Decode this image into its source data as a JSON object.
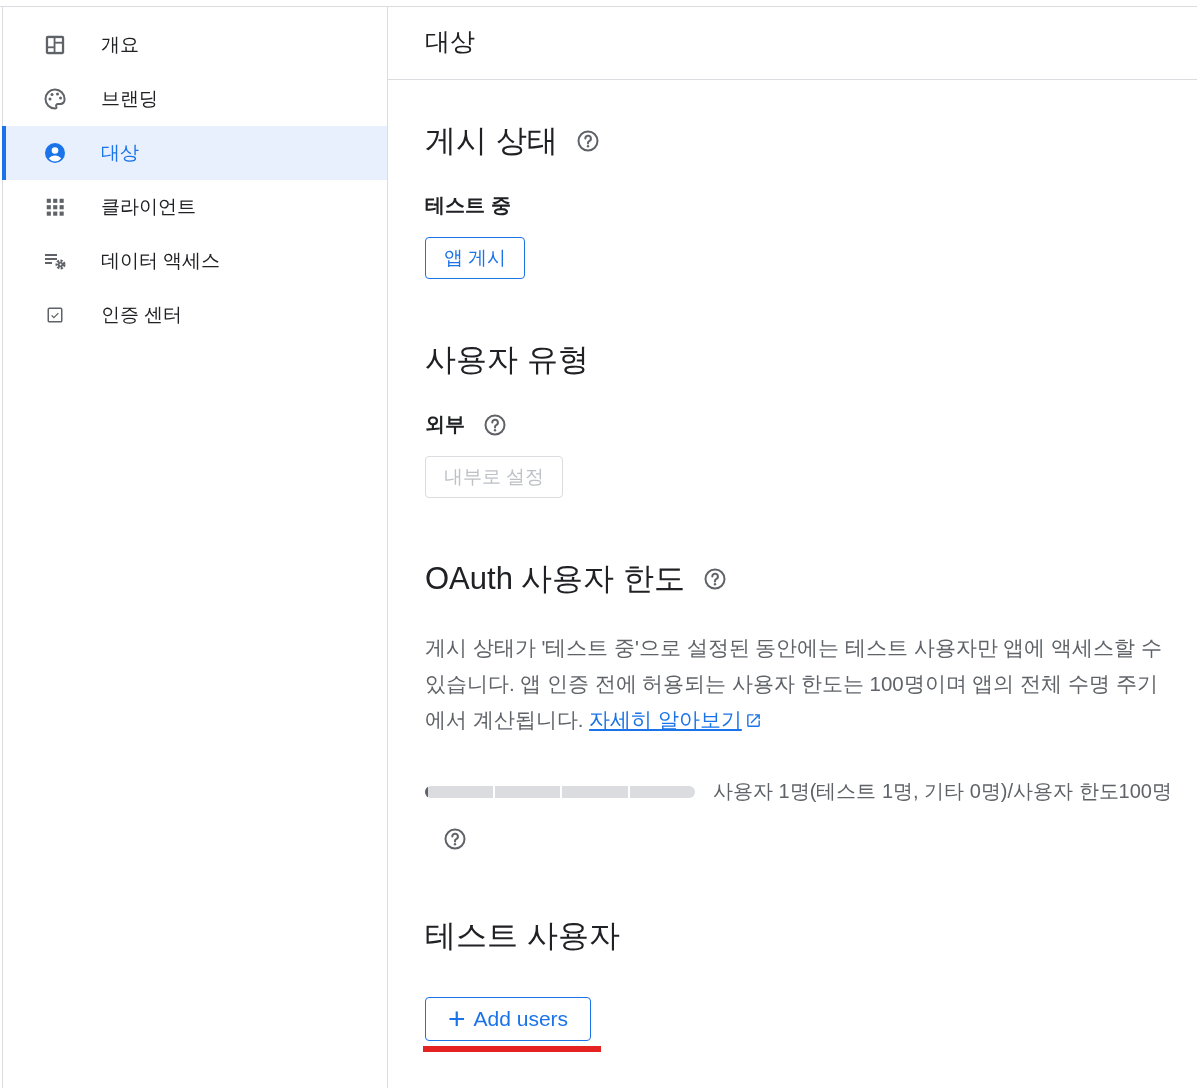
{
  "sidebar": {
    "items": [
      {
        "label": "개요",
        "selected": false
      },
      {
        "label": "브랜딩",
        "selected": false
      },
      {
        "label": "대상",
        "selected": true
      },
      {
        "label": "클라이언트",
        "selected": false
      },
      {
        "label": "데이터 액세스",
        "selected": false
      },
      {
        "label": "인증 센터",
        "selected": false
      }
    ]
  },
  "page_title": "대상",
  "publishing_status": {
    "heading": "게시 상태",
    "status": "테스트 중",
    "button": {
      "label": "앱 게시",
      "disabled": false
    }
  },
  "user_type": {
    "heading": "사용자 유형",
    "type": "외부",
    "button": {
      "label": "내부로 설정",
      "disabled": true
    }
  },
  "user_cap": {
    "heading": "OAuth 사용자 한도",
    "description": "게시 상태가 '테스트 중'으로 설정된 동안에는 테스트 사용자만 앱에 액세스할 수 있습니다. 앱 인증 전에 허용되는 사용자 한도는 100명이며 앱의 전체 수명 주기에서 계산됩니다.",
    "link": "자세히 알아보기",
    "level": 0.01,
    "reading": "사용자 1명(테스트 1명, 기타 0명)/사용자 한도100명"
  },
  "test_users": {
    "heading": "테스트 사용자",
    "button": {
      "icon": "+",
      "label": "Add users"
    }
  }
}
